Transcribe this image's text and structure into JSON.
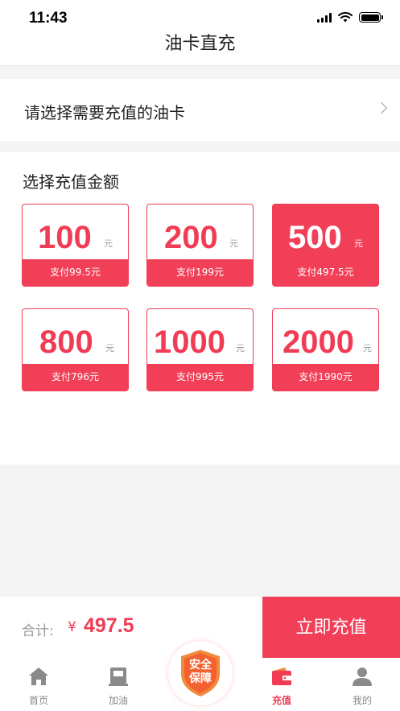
{
  "status_bar": {
    "time": "11:43"
  },
  "nav": {
    "title": "油卡直充"
  },
  "card_select": {
    "label": "请选择需要充值的油卡"
  },
  "amounts_section": {
    "title": "选择充值金额",
    "items": [
      {
        "amount": "100",
        "unit": "元",
        "pay": "支付99.5元",
        "selected": false
      },
      {
        "amount": "200",
        "unit": "元",
        "pay": "支付199元",
        "selected": false
      },
      {
        "amount": "500",
        "unit": "元",
        "pay": "支付497.5元",
        "selected": true
      },
      {
        "amount": "800",
        "unit": "元",
        "pay": "支付796元",
        "selected": false
      },
      {
        "amount": "1000",
        "unit": "元",
        "pay": "支付995元",
        "selected": false
      },
      {
        "amount": "2000",
        "unit": "元",
        "pay": "支付1990元",
        "selected": false
      }
    ]
  },
  "total": {
    "label": "合计:",
    "currency": "¥",
    "value": "497.5"
  },
  "pay_button": {
    "label": "立即充值"
  },
  "badge": {
    "line1": "安全",
    "line2": "保障"
  },
  "tabbar": {
    "items": [
      {
        "label": "首页",
        "icon": "home-icon"
      },
      {
        "label": "加油",
        "icon": "fuel-icon"
      },
      {
        "label": "充值",
        "icon": "wallet-icon",
        "active": true
      },
      {
        "label": "我的",
        "icon": "user-icon"
      }
    ]
  },
  "colors": {
    "accent": "#f23f58",
    "muted": "#999999",
    "background_band": "#f4f4f4"
  }
}
